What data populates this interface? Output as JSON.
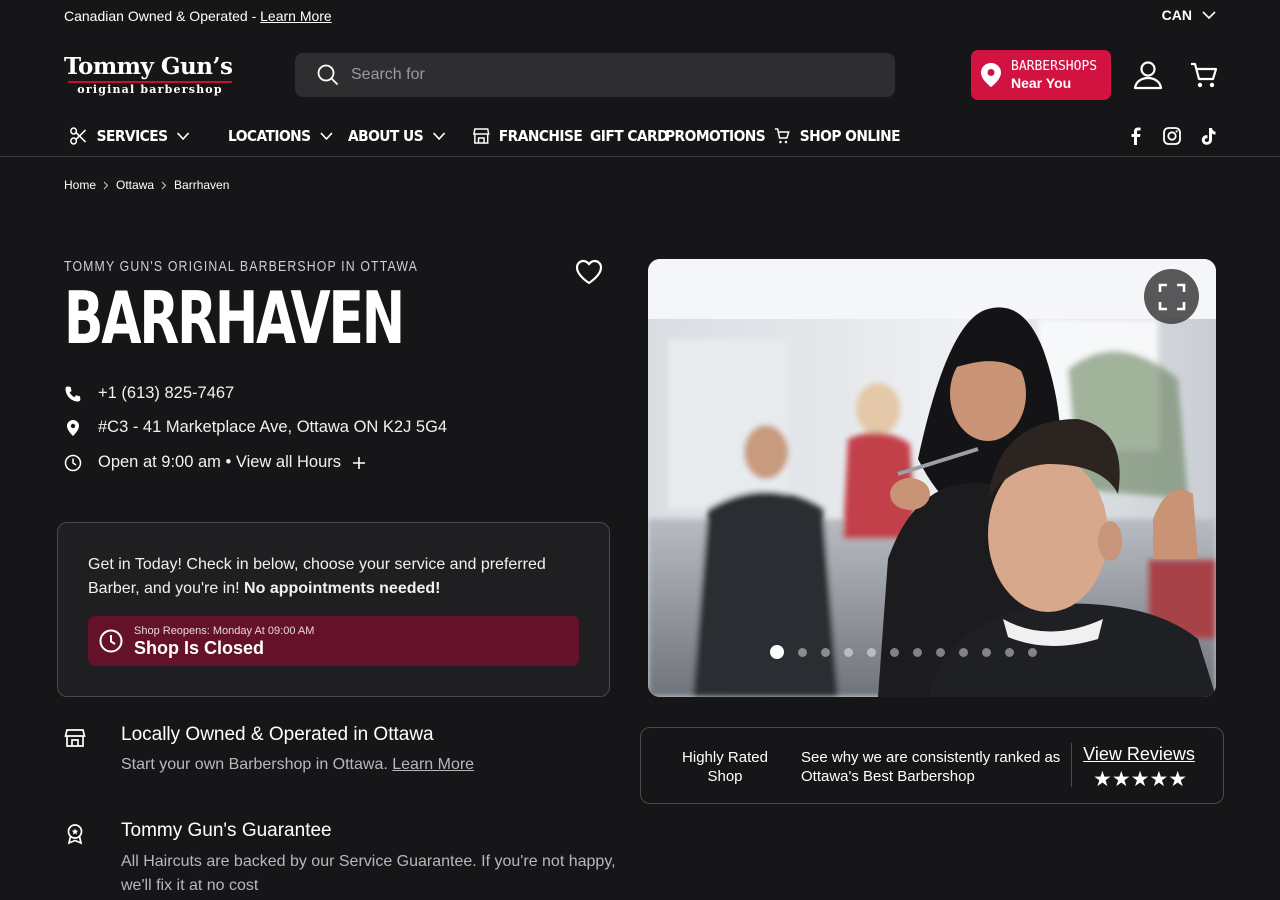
{
  "announcement": {
    "text": "Canadian Owned & Operated - ",
    "link": "Learn More"
  },
  "country": {
    "code": "CAN"
  },
  "logo": {
    "line1": "Tommy Gun’s",
    "line2": "original barbershop"
  },
  "search": {
    "placeholder": "Search for"
  },
  "near_button": {
    "line1": "BARBERSHOPS",
    "line2": "Near You"
  },
  "nav": {
    "services": "SERVICES",
    "locations": "LOCATIONS",
    "about": "ABOUT US",
    "franchise": "FRANCHISE",
    "gift_card": "GIFT CARD",
    "promotions": "PROMOTIONS",
    "shop_online": "SHOP ONLINE"
  },
  "social": [
    "facebook-icon",
    "instagram-icon",
    "tiktok-icon"
  ],
  "breadcrumb": [
    "Home",
    "Ottawa",
    "Barrhaven"
  ],
  "location": {
    "eyebrow": "TOMMY GUN'S ORIGINAL BARBERSHOP IN OTTAWA",
    "title": "BARRHAVEN",
    "phone": "+1 (613) 825-7467",
    "address": "#C3 - 41 Marketplace Ave, Ottawa ON K2J 5G4",
    "hours": "Open at 9:00 am • View all Hours"
  },
  "checkin": {
    "message": "Get in Today! Check in below, choose your service and preferred Barber, and you're in! ",
    "message_bold": "No appointments needed!",
    "status_sub": "Shop Reopens: Monday At 09:00 AM",
    "status_main": "Shop Is Closed"
  },
  "features": [
    {
      "title": "Locally Owned & Operated in Ottawa",
      "desc": "Start your own Barbershop in Ottawa. ",
      "link": "Learn More"
    },
    {
      "title": "Tommy Gun's Guarantee",
      "desc": "All Haircuts are backed by our Service Guarantee. If you're not happy, we'll fix it at no cost"
    }
  ],
  "gallery": {
    "slide_count": 12,
    "active_index": 0
  },
  "reviews": {
    "left": "Highly Rated Shop",
    "middle": "See why we are consistently ranked as Ottawa's Best Barbershop",
    "link": "View Reviews",
    "stars": "★★★★★"
  },
  "colors": {
    "background": "#161618",
    "accent": "#d21341",
    "closed": "#63122a"
  }
}
